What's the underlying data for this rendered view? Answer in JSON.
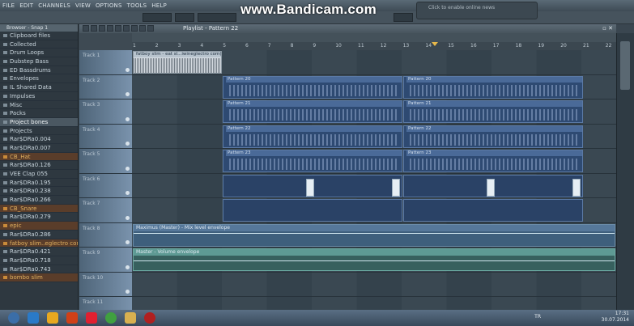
{
  "menu": [
    "FILE",
    "EDIT",
    "CHANNELS",
    "VIEW",
    "OPTIONS",
    "TOOLS",
    "HELP"
  ],
  "watermark": "www.Bandicam.com",
  "notification": "Click to enable online news",
  "browser": {
    "header": "Browser - Snap 1",
    "items": [
      {
        "label": "Clipboard files",
        "kind": "folder"
      },
      {
        "label": "Collected",
        "kind": "folder"
      },
      {
        "label": "Drum Loops",
        "kind": "folder"
      },
      {
        "label": "Dubstep Bass",
        "kind": "folder"
      },
      {
        "label": "ED Bassdrums",
        "kind": "folder"
      },
      {
        "label": "Envelopes",
        "kind": "folder"
      },
      {
        "label": "IL Shared Data",
        "kind": "folder"
      },
      {
        "label": "Impulses",
        "kind": "folder"
      },
      {
        "label": "Misc",
        "kind": "folder"
      },
      {
        "label": "Packs",
        "kind": "folder"
      },
      {
        "label": "Project bones",
        "kind": "folder",
        "hl": true
      },
      {
        "label": "Projects",
        "kind": "folder"
      },
      {
        "label": "Rar$DRa0.004",
        "kind": "folder"
      },
      {
        "label": "Rar$DRa0.007",
        "kind": "folder"
      },
      {
        "label": "CB_Hat",
        "kind": "sample",
        "sel": true
      },
      {
        "label": "Rar$DRa0.126",
        "kind": "folder"
      },
      {
        "label": "VEE Clap 055",
        "kind": "folder"
      },
      {
        "label": "Rar$DRa0.195",
        "kind": "folder"
      },
      {
        "label": "Rar$DRa0.238",
        "kind": "folder"
      },
      {
        "label": "Rar$DRa0.266",
        "kind": "folder"
      },
      {
        "label": "CB_Snare",
        "kind": "sample",
        "sel": true
      },
      {
        "label": "Rar$DRa0.279",
        "kind": "folder"
      },
      {
        "label": "epic",
        "kind": "sample",
        "sel": true
      },
      {
        "label": "Rar$DRa0.286",
        "kind": "folder"
      },
      {
        "label": "fatboy slim..eglectro com(2)",
        "kind": "sample",
        "sel": true
      },
      {
        "label": "Rar$DRa0.421",
        "kind": "folder"
      },
      {
        "label": "Rar$DRa0.718",
        "kind": "folder"
      },
      {
        "label": "Rar$DRa0.743",
        "kind": "folder"
      },
      {
        "label": "bombo slim",
        "kind": "sample",
        "sel": true
      }
    ]
  },
  "playlist": {
    "title": "Playlist - Pattern 22",
    "ruler": [
      "1",
      "2",
      "3",
      "4",
      "5",
      "6",
      "7",
      "8",
      "9",
      "10",
      "11",
      "12",
      "13",
      "14",
      "15",
      "16",
      "17",
      "18",
      "19",
      "20",
      "21",
      "22"
    ],
    "tracks": [
      "Track 1",
      "Track 2",
      "Track 3",
      "Track 4",
      "Track 5",
      "Track 6",
      "Track 7",
      "Track 8",
      "Track 9",
      "Track 10",
      "Track 11"
    ],
    "audio_clip": "fatboy slim - eat sl...iwineglectro com(2)",
    "patterns": [
      {
        "track": 2,
        "name": "Pattern 20"
      },
      {
        "track": 3,
        "name": "Pattern 21"
      },
      {
        "track": 4,
        "name": "Pattern 22"
      },
      {
        "track": 5,
        "name": "Pattern 23"
      }
    ],
    "automation": [
      {
        "track": 8,
        "name": "Maximus (Master) - Mix level envelope"
      },
      {
        "track": 9,
        "name": "Master - Volume envelope"
      }
    ]
  },
  "taskbar": {
    "lang": "TR",
    "time": "17:31",
    "date": "30.07.2014"
  }
}
